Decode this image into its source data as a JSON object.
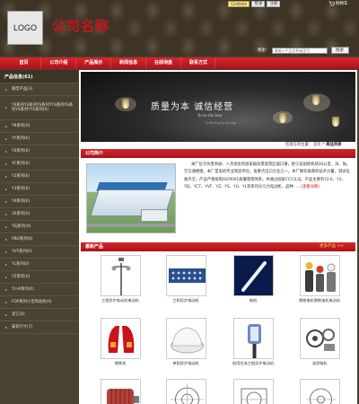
{
  "header": {
    "logo_text": "LOGO",
    "company_name": "公司名称",
    "top_links": [
      "Goldsite",
      "登录",
      "注册"
    ],
    "cart_label": "购物车",
    "search_label": "搜索：",
    "search_placeholder": "请输入产品名称或型号",
    "search_button": "搜索"
  },
  "nav": [
    "首页",
    "公司介绍",
    "产品展示",
    "新闻信息",
    "在线询盘",
    "联系方式"
  ],
  "sidebar": {
    "title": "产品信息(61)",
    "items": [
      "微型产品(3)",
      "YS系列YS系列YS系列YYS系列YS系列YS系列YYS系列(0)",
      "YB系列(0)",
      "YY系列(0)",
      "YS系列(0)",
      "YC系列(0)",
      "Y2系列(0)",
      "Y3系列(0)",
      "Y4系列(0)",
      "3S系列(0)",
      "YEJ系列(0)",
      "PBO系列(0)",
      "YVF系列(0)",
      "YL系列(0)",
      "YZ系列(0)",
      "YU-K系列(0)",
      "FOP系列小型风动机(0)",
      "其它(0)",
      "安装尺寸(7)"
    ]
  },
  "banner": {
    "slogan": "质量为本 诚信经营",
    "sub1": "To be the best",
    "sub2": "To develop by prestige"
  },
  "breadcrumb": {
    "prefix": "您现在的位置：",
    "home": "首页",
    "sep": " > ",
    "current": "商品列表"
  },
  "intro": {
    "title": "公司简介",
    "text": "本厂位于风景秀丽、人杰地灵的国家级风景旅游区城口镇，距宁波国际机场30公里，海、陆、空交通便捷。本厂是电机专业制造单位，省重点出口企业之一。本厂拥有雄厚的技术力量，测试设备齐全，产品严格按照ISO9001质量管理体系，并通过国家CCC认证。产品主要有Y2-E、Y3、YEJ、YCT、YVF、YZ、YS、YU、YL等系列分马力电动机，品种……",
    "more": "[查看详情]"
  },
  "products": {
    "title": "最新产品",
    "more": "更多产品 >>",
    "items": [
      {
        "name": "三相异步电动机电动机",
        "icon": "lamp-post-icon"
      },
      {
        "name": "三相异步电动机",
        "icon": "led-panel-icon"
      },
      {
        "name": "电机",
        "icon": "tube-light-icon"
      },
      {
        "name": "钢铁电机钢铁电机电动机",
        "icon": "machine-set-icon"
      },
      {
        "name": "钢铁机",
        "icon": "tail-light-icon"
      },
      {
        "name": "单相异步电动机",
        "icon": "lamp-shade-icon"
      },
      {
        "name": "船用交流三相异步电动机",
        "icon": "street-lamp-icon"
      },
      {
        "name": "油浸电机",
        "icon": "motor-parts-icon"
      },
      {
        "name": "",
        "icon": "motor-icon"
      },
      {
        "name": "",
        "icon": "drawing-icon"
      },
      {
        "name": "",
        "icon": "drawing-icon"
      },
      {
        "name": "",
        "icon": "drawing-icon"
      }
    ]
  },
  "colors": {
    "brand_red": "#c8141a",
    "nav_red": "#d8252b",
    "sidebar_bg": "#4a4233",
    "header_bg": "#3d3426"
  }
}
